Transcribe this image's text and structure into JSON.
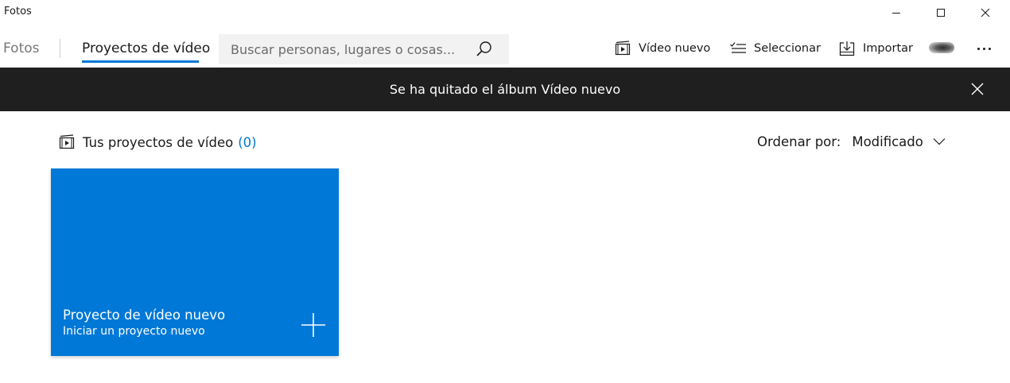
{
  "window": {
    "title": "Fotos"
  },
  "nav": {
    "tabs": [
      {
        "label": "Fotos",
        "active": false
      },
      {
        "label": "Proyectos de vídeo",
        "active": true
      }
    ],
    "accent": "#0078d7"
  },
  "search": {
    "placeholder": "Buscar personas, lugares o cosas...",
    "value": "",
    "icon": "search-icon"
  },
  "commands": {
    "new_video": {
      "label": "Vídeo nuevo",
      "icon": "video-project-icon"
    },
    "select": {
      "label": "Seleccionar",
      "icon": "select-list-icon"
    },
    "import": {
      "label": "Importar",
      "icon": "import-icon"
    },
    "more_icon": "more-icon"
  },
  "banner": {
    "message": "Se ha quitado el álbum Vídeo nuevo",
    "background": "#1f1f1f"
  },
  "projects": {
    "heading": "Tus proyectos de vídeo",
    "count": "(0)",
    "sort_label": "Ordenar por:",
    "sort_value": "Modificado",
    "new_tile": {
      "title": "Proyecto de vídeo nuevo",
      "subtitle": "Iniciar un proyecto nuevo",
      "color": "#0078d7"
    }
  }
}
